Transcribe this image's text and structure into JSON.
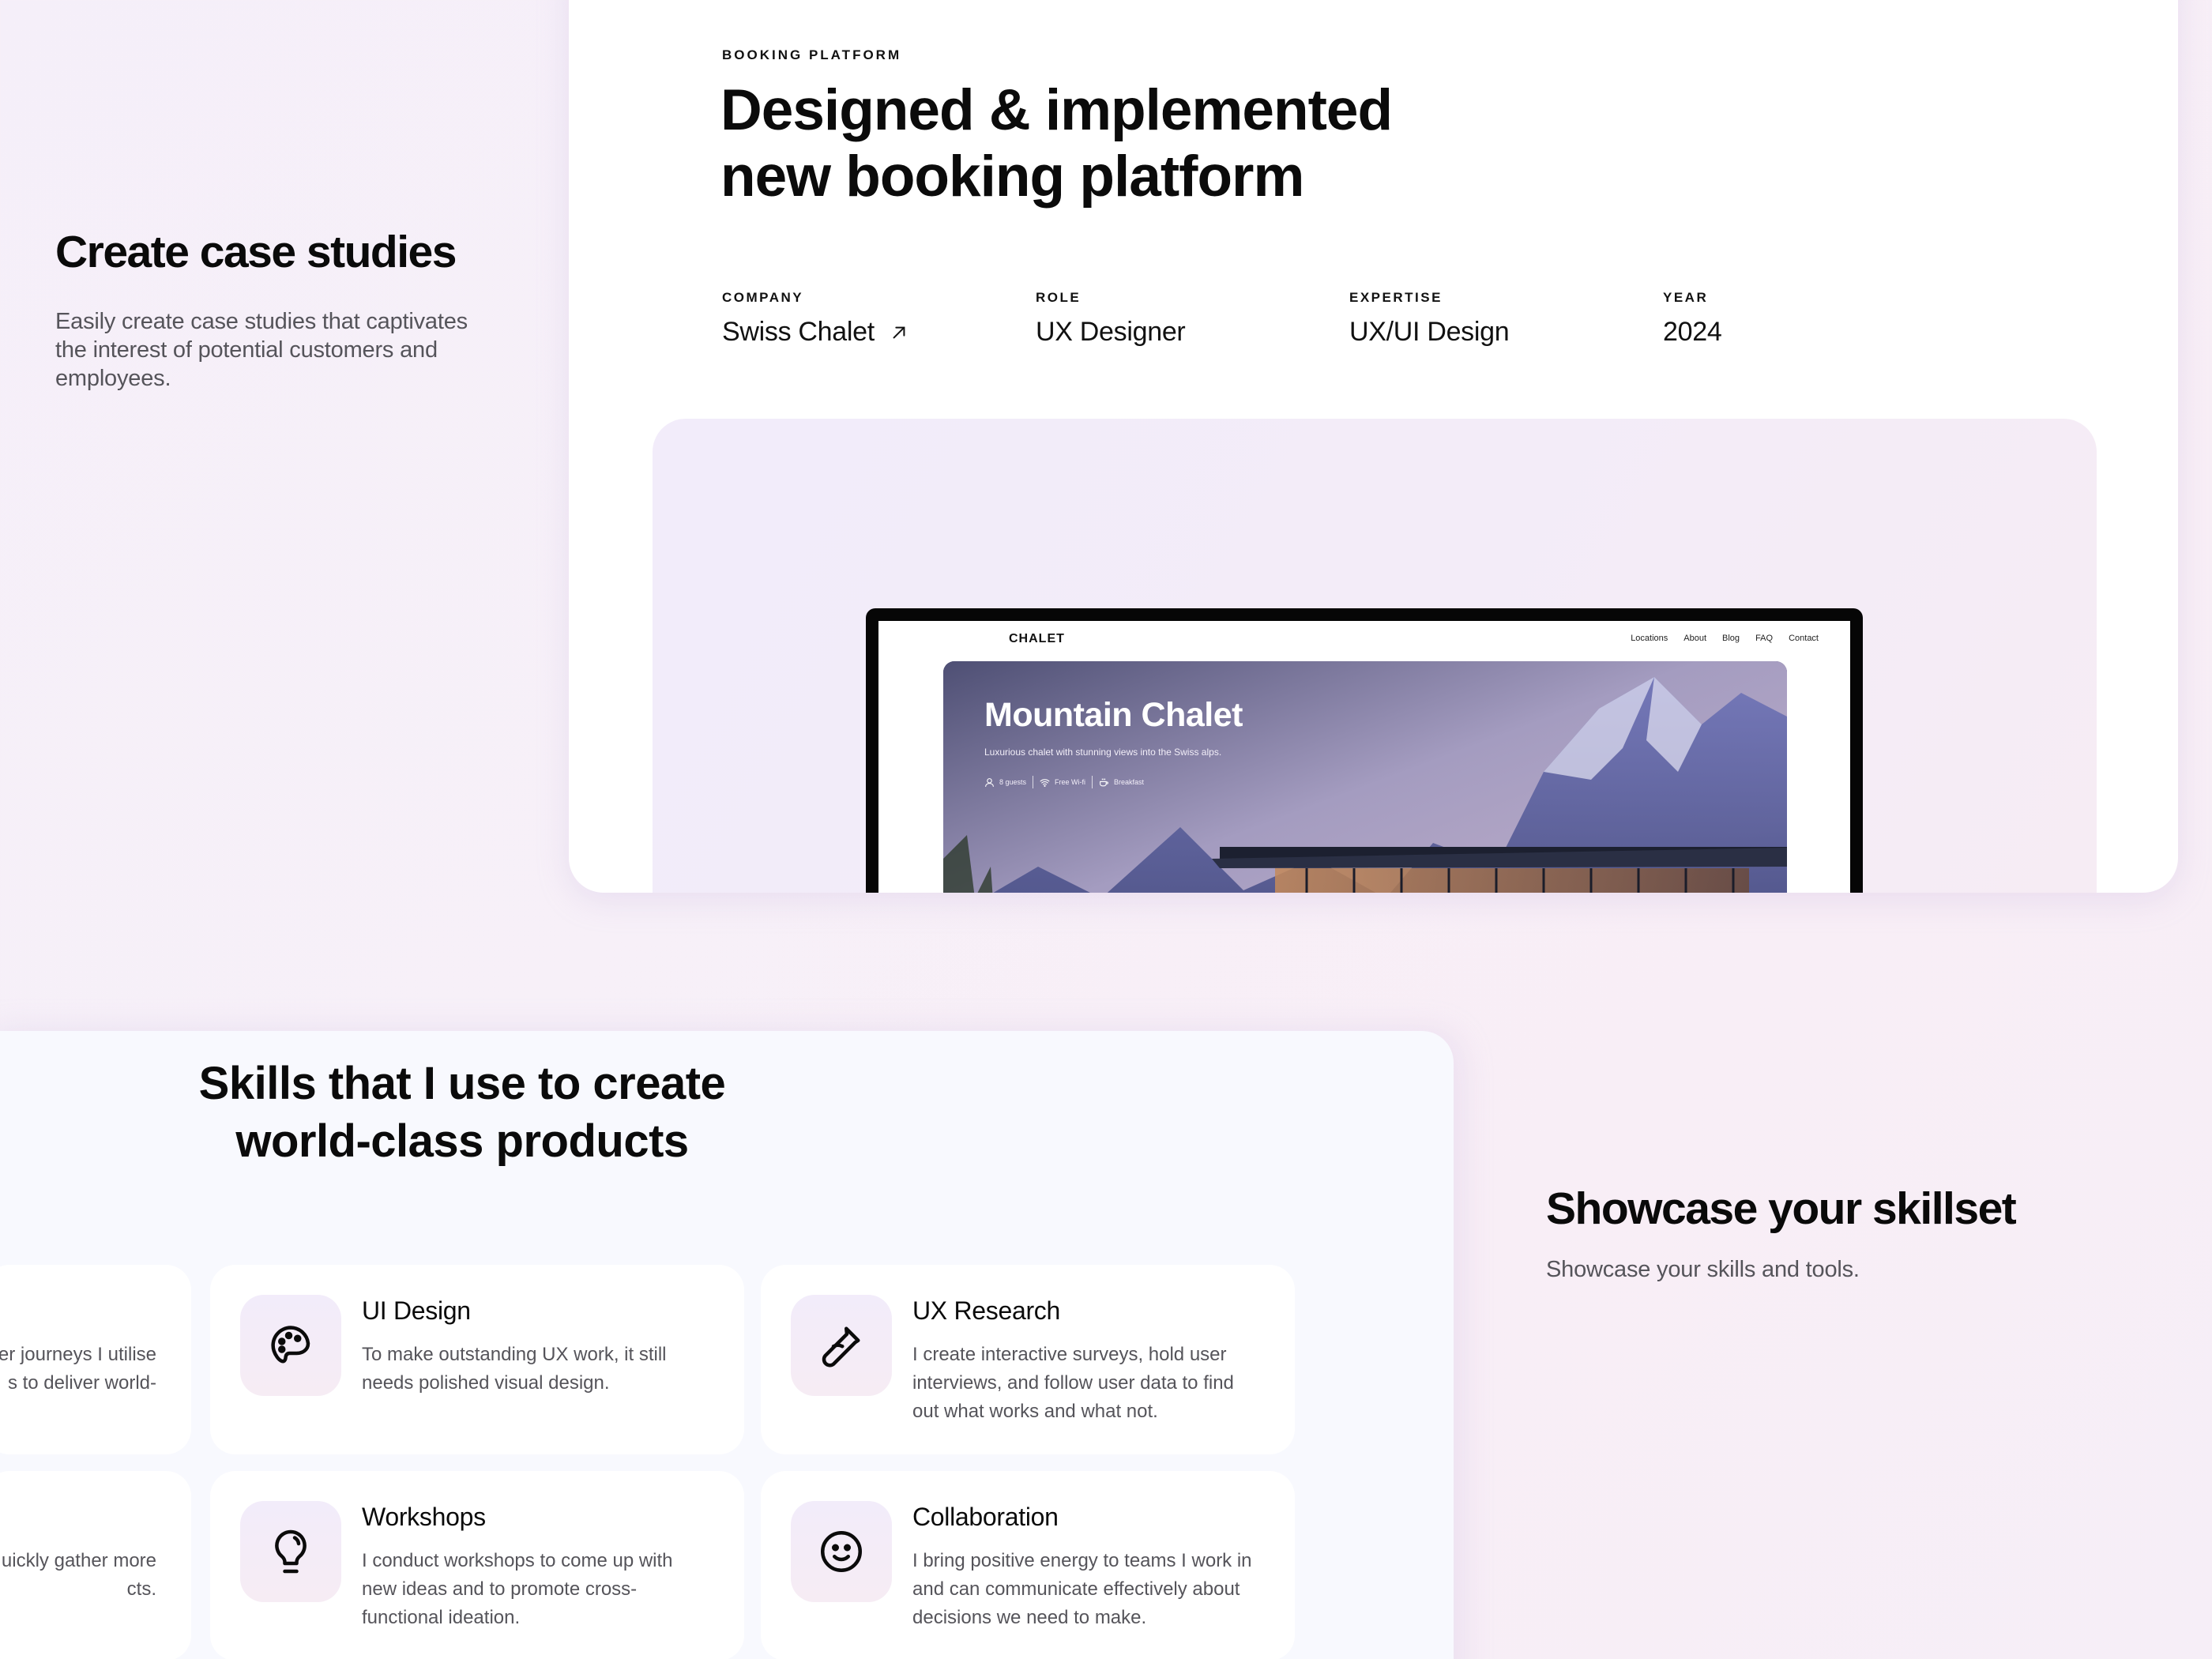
{
  "case_studies_intro": {
    "title": "Create case studies",
    "description": "Easily create case studies that captivates the interest of potential customers and employees."
  },
  "case_study": {
    "eyebrow": "BOOKING PLATFORM",
    "title_line1": "Designed & implemented",
    "title_line2": "new booking platform",
    "meta": [
      {
        "label": "COMPANY",
        "value": "Swiss Chalet",
        "icon": "arrow-up-right-icon"
      },
      {
        "label": "ROLE",
        "value": "UX Designer"
      },
      {
        "label": "EXPERTISE",
        "value": "UX/UI Design"
      },
      {
        "label": "YEAR",
        "value": "2024"
      }
    ],
    "mockup": {
      "logo": "CHALET",
      "nav_links": [
        "Locations",
        "About",
        "Blog",
        "FAQ",
        "Contact"
      ],
      "hero_title": "Mountain Chalet",
      "hero_subtitle": "Luxurious chalet with stunning views into the Swiss alps.",
      "features": [
        {
          "icon": "user-icon",
          "label": "8 guests"
        },
        {
          "icon": "wifi-icon",
          "label": "Free Wi-fi"
        },
        {
          "icon": "coffee-cup-icon",
          "label": "Breakfast"
        }
      ]
    }
  },
  "skills_section": {
    "title_line1": "Skills that I use to create",
    "title_line2": "world-class products",
    "partial_tiles": [
      {
        "desc_line1": "er journeys I utilise",
        "desc_line2": "s to deliver world-"
      },
      {
        "desc_line1": "uickly gather more",
        "desc_line2": "cts."
      }
    ],
    "skills": [
      {
        "icon": "palette-icon",
        "name": "UI Design",
        "description": "To make outstanding UX work, it still needs polished visual design."
      },
      {
        "icon": "test-tube-icon",
        "name": "UX Research",
        "description": "I create interactive surveys, hold user interviews, and follow user data to find out what works and what not."
      },
      {
        "icon": "lightbulb-icon",
        "name": "Workshops",
        "description": "I conduct workshops to come up with new ideas and to promote cross-functional ideation."
      },
      {
        "icon": "smiley-icon",
        "name": "Collaboration",
        "description": "I bring positive energy to teams I work in and can communicate effectively about decisions we need to make."
      }
    ]
  },
  "skillset_intro": {
    "title": "Showcase your skillset",
    "description": "Showcase your skills and tools."
  }
}
